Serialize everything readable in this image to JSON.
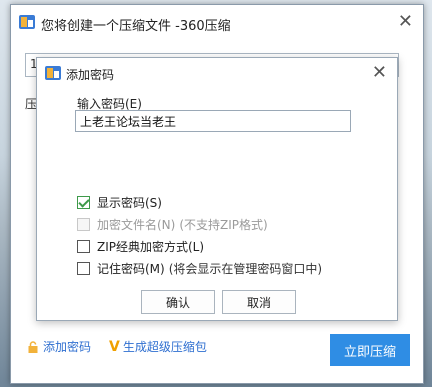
{
  "outer_window": {
    "title": "您将创建一个压缩文件 -360压缩",
    "path_prefix": "1",
    "path_right_icon": "ii",
    "side_label": "压",
    "add_password_link": "添加密码",
    "super_package_link": "生成超级压缩包",
    "compress_button": "立即压缩"
  },
  "dialog": {
    "title": "添加密码",
    "password_label": "输入密码(E)",
    "password_value": "上老王论坛当老王",
    "options": [
      {
        "label": "显示密码(S)",
        "note": "",
        "checked": true,
        "disabled": false
      },
      {
        "label": "加密文件名(N)",
        "note": "(不支持ZIP格式)",
        "checked": false,
        "disabled": true
      },
      {
        "label": "ZIP经典加密方式(L)",
        "note": "",
        "checked": false,
        "disabled": false
      },
      {
        "label": "记住密码(M)",
        "note": "(将会显示在管理密码窗口中)",
        "checked": false,
        "disabled": false
      }
    ],
    "ok_button": "确认",
    "cancel_button": "取消"
  },
  "colors": {
    "accent": "#2f8de4",
    "check": "#3e9a4a",
    "link": "#2f6fd0"
  },
  "icons": {
    "app": "360zip-app-icon",
    "close": "close-icon",
    "lock": "lock-icon",
    "v": "v-badge-icon"
  }
}
